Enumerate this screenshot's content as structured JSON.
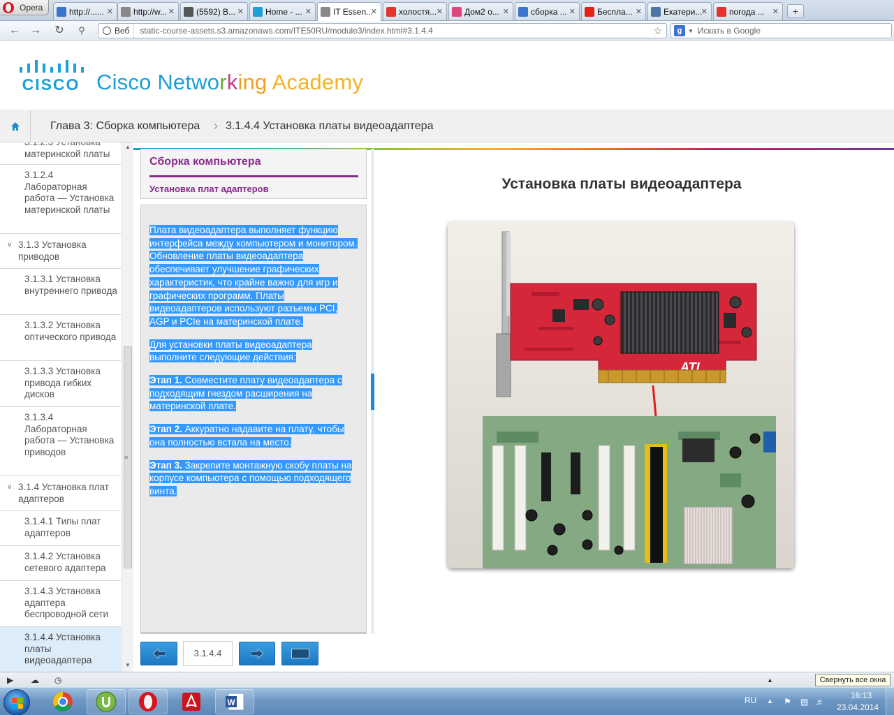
{
  "browser": {
    "opera_label": "Opera",
    "tabs": [
      {
        "title": "http://......",
        "icon": "compass-icon",
        "color": "#3a73d0"
      },
      {
        "title": "http://w...",
        "icon": "page-icon",
        "color": "#888888"
      },
      {
        "title": "(5592) В...",
        "icon": "mail-icon",
        "color": "#555555"
      },
      {
        "title": "Home - ...",
        "icon": "cisco-icon",
        "color": "#1ba0d7"
      },
      {
        "title": "IT Essen...",
        "icon": "page-icon",
        "color": "#888888"
      },
      {
        "title": "холостя...",
        "icon": "yandex-icon",
        "color": "#e6322a"
      },
      {
        "title": "Дом2 о...",
        "icon": "flower-icon",
        "color": "#e0457b"
      },
      {
        "title": "сборка ...",
        "icon": "google-icon",
        "color": "#3a73d0"
      },
      {
        "title": "Бесплa...",
        "icon": "youtube-icon",
        "color": "#e62117"
      },
      {
        "title": "Екатери...",
        "icon": "vk-icon",
        "color": "#4d75a3"
      },
      {
        "title": "погода ...",
        "icon": "yandex-icon",
        "color": "#e6322a"
      }
    ],
    "new_tab": "+",
    "web_badge": "Веб",
    "url": "static-course-assets.s3.amazonaws.com/ITE50RU/module3/index.html#3.1.4.4",
    "search_placeholder": "Искать в Google"
  },
  "header": {
    "cisco_word": "CISCO",
    "academy_words": [
      {
        "text": "Cisco ",
        "color": "#1ba0d7"
      },
      {
        "text": "Netwo",
        "color": "#1ba0d7"
      },
      {
        "text": "r",
        "color": "#6aaa3a"
      },
      {
        "text": "k",
        "color": "#c1408c"
      },
      {
        "text": "ing ",
        "color": "#f29e1f"
      },
      {
        "text": "Academy",
        "color": "#f4b41f"
      }
    ]
  },
  "breadcrumb": {
    "chapter": "Глава 3: Сборка компьютера",
    "separator": "›",
    "topic": "3.1.4.4 Установка платы видеоадаптера"
  },
  "sidenav": {
    "items": [
      {
        "label": "3.1.2.3 Установка материнской платы",
        "level": "page",
        "state": ""
      },
      {
        "label": "3.1.2.4 Лабораторная работа — Установка материнской платы",
        "level": "page",
        "state": ""
      },
      {
        "label": "3.1.3 Установка приводов",
        "level": "topic",
        "state": "expanded"
      },
      {
        "label": "3.1.3.1 Установка внутреннего привода",
        "level": "page",
        "state": ""
      },
      {
        "label": "3.1.3.2 Установка оптического привода",
        "level": "page",
        "state": ""
      },
      {
        "label": "3.1.3.3 Установка привода гибких дисков",
        "level": "page",
        "state": ""
      },
      {
        "label": "3.1.3.4 Лабораторная работа — Установка приводов",
        "level": "page",
        "state": ""
      },
      {
        "label": "3.1.4 Установка плат адаптеров",
        "level": "topic",
        "state": "expanded"
      },
      {
        "label": "3.1.4.1 Типы плат адаптеров",
        "level": "page",
        "state": ""
      },
      {
        "label": "3.1.4.2 Установка сетевого адаптера",
        "level": "page",
        "state": ""
      },
      {
        "label": "3.1.4.3 Установка адаптера беспроводной сети",
        "level": "page",
        "state": ""
      },
      {
        "label": "3.1.4.4 Установка платы видеоадаптера",
        "level": "page",
        "state": "current"
      }
    ]
  },
  "content": {
    "section_title": "Сборка компьютера",
    "subsection_title": "Установка плат адаптеров",
    "intro": "Плата видеоадаптера выполняет функцию интерфейса между компьютером и монитором. Обновление платы видеоадаптера обеспечивает улучшение графических характеристик, что крайне важно для игр и графических программ. Платы видеоадаптеров используют разъемы PCI, AGP и PCIe на материнской плате.",
    "lead": "Для установки платы видеоадаптера выполните следующие действия:",
    "steps": [
      {
        "label": "Этап 1.",
        "text": " Совместите плату видеоадаптера с подходящим гнездом расширения на материнской плате."
      },
      {
        "label": "Этап 2.",
        "text": " Аккуратно надавите на плату, чтобы она полностью встала на место."
      },
      {
        "label": "Этап 3.",
        "text": " Закрепите монтажную скобу платы на корпусе компьютера с помощью подходящего винта."
      }
    ],
    "selection_color": "#3399ff"
  },
  "pager": {
    "page_number": "3.1.4.4",
    "prev_icon": "arrow-left-icon",
    "next_icon": "arrow-right-icon",
    "screen_icon": "fullscreen-icon"
  },
  "media": {
    "title": "Установка платы видеоадаптера",
    "card_brand": "ATI"
  },
  "statusbar": {
    "collapse_all": "Свернуть все окна"
  },
  "taskbar": {
    "apps": [
      {
        "name": "chrome",
        "icon": "chrome-icon"
      },
      {
        "name": "utorrent",
        "icon": "utorrent-icon"
      },
      {
        "name": "opera",
        "icon": "opera-icon"
      },
      {
        "name": "acrobat",
        "icon": "acrobat-icon"
      },
      {
        "name": "word",
        "icon": "word-icon"
      }
    ],
    "language": "RU",
    "time": "16:13",
    "date": "23.04.2014"
  }
}
